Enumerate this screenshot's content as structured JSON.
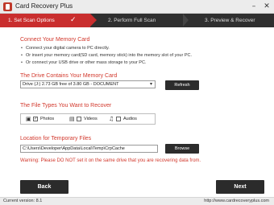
{
  "window": {
    "title": "Card Recovery Plus",
    "minimize_icon": "minimize-icon",
    "close_icon": "close-icon"
  },
  "steps": [
    {
      "label": "1. Set Scan Options",
      "state": "active",
      "check": "✓"
    },
    {
      "label": "2. Perform Full Scan",
      "state": "inactive"
    },
    {
      "label": "3. Preview & Recover",
      "state": "inactive"
    }
  ],
  "connect": {
    "title": "Connect Your Memory Card",
    "bullets": [
      "Connect your digital camera to PC directly.",
      "Or insert your memory card(SD card, memory stick) into the memory slot of your PC.",
      "Or connect your USB drive or other mass storage to your PC."
    ]
  },
  "drive": {
    "title": "The Drive Contains Your Memory Card",
    "selected": "Drive (J:) 2.73 GB free of 3.80 GB - DOCUMENT",
    "refresh_label": "Refresh"
  },
  "file_types": {
    "title": "The File Types You Want to Recover",
    "items": [
      {
        "label": "Photos",
        "checked": true,
        "icon": "photo-icon"
      },
      {
        "label": "Videos",
        "checked": false,
        "icon": "video-icon"
      },
      {
        "label": "Audios",
        "checked": false,
        "icon": "audio-icon"
      }
    ]
  },
  "temp": {
    "title": "Location for Temporary Files",
    "path": "C:\\Users\\Developer\\AppData\\Local\\Temp\\CrpCache",
    "browse_label": "Browse",
    "warning": "Warning: Please DO NOT set it on the same drive that you are recovering data from."
  },
  "nav": {
    "back_label": "Back",
    "next_label": "Next"
  },
  "status": {
    "version": "Current version: 8.1",
    "website": "http://www.cardrecoveryplus.com"
  },
  "colors": {
    "accent": "#d2382c",
    "step_active": "#c92e2e",
    "dark": "#2b2b2b"
  }
}
